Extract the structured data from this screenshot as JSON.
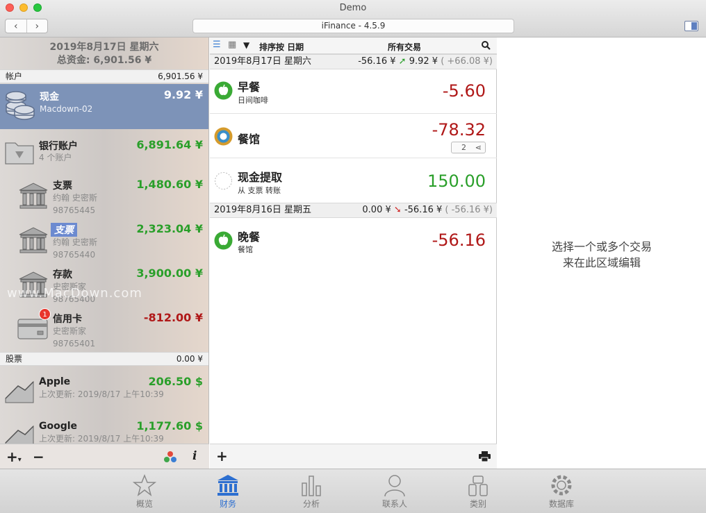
{
  "window": {
    "title": "Demo",
    "app_version": "iFinance - 4.5.9"
  },
  "left_header": {
    "date": "2019年8月17日 星期六",
    "total": "总资金: 6,901.56 ¥"
  },
  "accounts_section": {
    "label": "帐户",
    "amount": "6,901.56 ¥"
  },
  "cash": {
    "name": "现金",
    "amount": "9.92 ¥",
    "sub": "Macdown-02"
  },
  "bank": {
    "name": "银行账户",
    "amount": "6,891.64 ¥",
    "sub": "4 个账户"
  },
  "bank_accounts": [
    {
      "name": "支票",
      "amount": "1,480.60 ¥",
      "owner": "约翰 史密斯",
      "number": "98765445"
    },
    {
      "name": "支票",
      "amount": "2,323.04 ¥",
      "owner": "约翰 史密斯",
      "number": "98765440"
    },
    {
      "name": "存款",
      "amount": "3,900.00 ¥",
      "owner": "史密斯家",
      "number": "98765400"
    },
    {
      "name": "信用卡",
      "amount": "-812.00 ¥",
      "owner": "史密斯家",
      "number": "98765401",
      "badge": "1"
    }
  ],
  "stocks_section": {
    "label": "股票",
    "amount": "0.00 ¥"
  },
  "stocks": [
    {
      "name": "Apple",
      "amount": "206.50 $",
      "updated": "上次更新: 2019/8/17 上午10:39"
    },
    {
      "name": "Google",
      "amount": "1,177.60 $",
      "updated": "上次更新: 2019/8/17 上午10:39"
    }
  ],
  "middle_header": {
    "sort": "排序按 日期",
    "filter": "所有交易"
  },
  "day1": {
    "date": "2019年8月17日 星期六",
    "change": "-56.16 ¥",
    "balance": "9.92 ¥",
    "diff": "( +66.08 ¥)"
  },
  "day2": {
    "date": "2019年8月16日 星期五",
    "change": "0.00 ¥",
    "balance": "-56.16 ¥",
    "diff": "( -56.16 ¥)"
  },
  "transactions": [
    {
      "title": "早餐",
      "desc": "日间咖啡",
      "amount": "-5.60"
    },
    {
      "title": "餐馆",
      "desc": "",
      "amount": "-78.32",
      "splits": "2"
    },
    {
      "title": "现金提取",
      "desc": "从 支票 转账",
      "amount": "150.00"
    },
    {
      "title": "晚餐",
      "desc": "餐馆",
      "amount": "-56.16"
    }
  ],
  "right_panel": {
    "line1": "选择一个或多个交易",
    "line2": "来在此区域编辑"
  },
  "watermark": "www.MacDown.com",
  "tabs": [
    {
      "label": "概览",
      "icon": "star-icon"
    },
    {
      "label": "财务",
      "icon": "bank-icon",
      "active": true
    },
    {
      "label": "分析",
      "icon": "bar-chart-icon"
    },
    {
      "label": "联系人",
      "icon": "person-icon"
    },
    {
      "label": "类别",
      "icon": "category-icon"
    },
    {
      "label": "数据库",
      "icon": "gear-icon"
    }
  ],
  "colors": {
    "positive": "#2a9f2a",
    "negative": "#b01818",
    "selection": "#7d93b8",
    "tab_active": "#2d6fd0"
  }
}
